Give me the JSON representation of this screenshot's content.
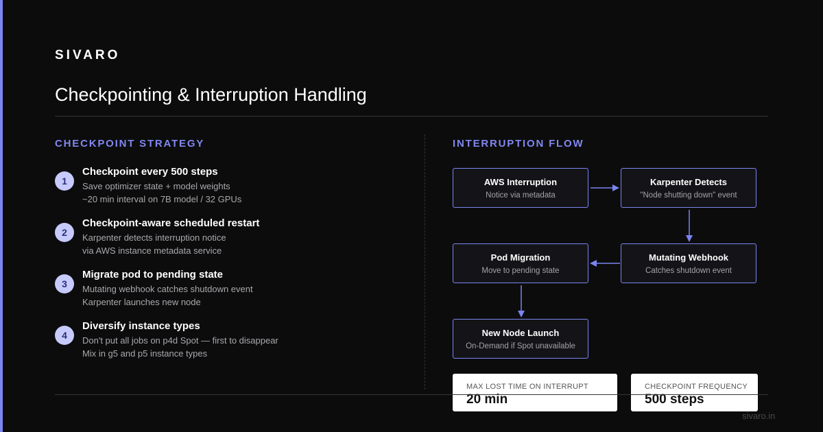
{
  "brand": "SIVARO",
  "title": "Checkpointing & Interruption Handling",
  "left_section": {
    "label": "CHECKPOINT STRATEGY",
    "steps": [
      {
        "num": "1",
        "title": "Checkpoint every 500 steps",
        "line1": "Save optimizer state + model weights",
        "line2": "~20 min interval on 7B model / 32 GPUs"
      },
      {
        "num": "2",
        "title": "Checkpoint-aware scheduled restart",
        "line1": "Karpenter detects interruption notice",
        "line2": "via AWS instance metadata service"
      },
      {
        "num": "3",
        "title": "Migrate pod to pending state",
        "line1": "Mutating webhook catches shutdown event",
        "line2": "Karpenter launches new node"
      },
      {
        "num": "4",
        "title": "Diversify instance types",
        "line1": "Don't put all jobs on p4d Spot — first to disappear",
        "line2": "Mix in g5 and p5 instance types"
      }
    ]
  },
  "right_section": {
    "label": "INTERRUPTION FLOW",
    "nodes": [
      {
        "title": "AWS Interruption",
        "sub": "Notice via metadata"
      },
      {
        "title": "Karpenter Detects",
        "sub": "\"Node shutting down\" event"
      },
      {
        "title": "Mutating Webhook",
        "sub": "Catches shutdown event"
      },
      {
        "title": "Pod Migration",
        "sub": "Move to pending state"
      },
      {
        "title": "New Node Launch",
        "sub": "On-Demand if Spot unavailable"
      }
    ],
    "stats": [
      {
        "label": "MAX LOST TIME ON INTERRUPT",
        "value": "20 min"
      },
      {
        "label": "CHECKPOINT FREQUENCY",
        "value": "500 steps"
      }
    ]
  },
  "footer_url": "sivaro.in",
  "colors": {
    "accent": "#7b85f0",
    "background": "#0c0c0d",
    "badge": "#c7cbfb"
  }
}
